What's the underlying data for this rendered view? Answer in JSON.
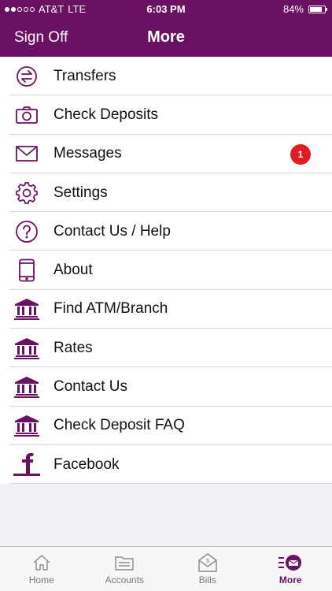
{
  "status_bar": {
    "carrier": "AT&T",
    "network": "LTE",
    "time": "6:03 PM",
    "battery": "84%",
    "battery_level": 0.84
  },
  "nav": {
    "left_button": "Sign Off",
    "title": "More"
  },
  "menu": [
    {
      "label": "Transfers",
      "icon": "transfer-icon"
    },
    {
      "label": "Check Deposits",
      "icon": "camera-icon"
    },
    {
      "label": "Messages",
      "icon": "envelope-icon",
      "badge": "1"
    },
    {
      "label": "Settings",
      "icon": "gear-icon"
    },
    {
      "label": "Contact Us / Help",
      "icon": "question-icon"
    },
    {
      "label": "About",
      "icon": "phone-icon"
    },
    {
      "label": "Find ATM/Branch",
      "icon": "bank-icon"
    },
    {
      "label": "Rates",
      "icon": "bank-icon"
    },
    {
      "label": "Contact Us",
      "icon": "bank-icon"
    },
    {
      "label": "Check Deposit FAQ",
      "icon": "bank-icon"
    },
    {
      "label": "Facebook",
      "icon": "facebook-icon"
    }
  ],
  "tabs": [
    {
      "label": "Home",
      "icon": "home-icon"
    },
    {
      "label": "Accounts",
      "icon": "accounts-icon"
    },
    {
      "label": "Bills",
      "icon": "bills-icon"
    },
    {
      "label": "More",
      "icon": "more-icon",
      "active": true
    }
  ],
  "colors": {
    "brand": "#6b1164",
    "badge": "#e01b24"
  }
}
